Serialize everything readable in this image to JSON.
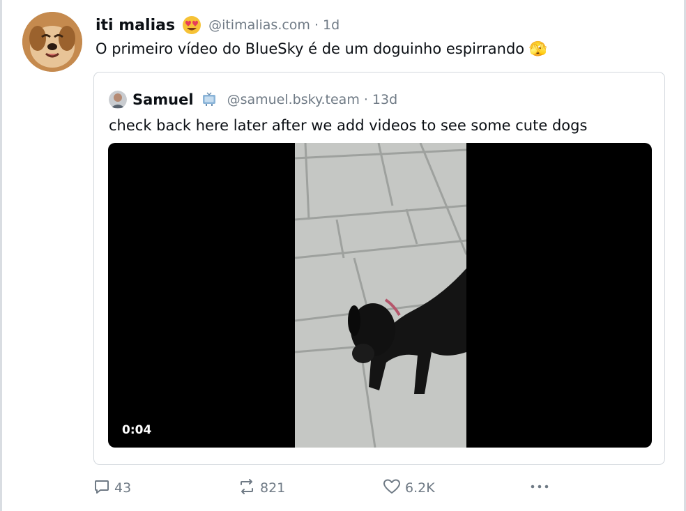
{
  "post": {
    "author": {
      "display_name": "iti malias",
      "emoji": "heart-eyes-emoji",
      "handle": "@itimalias.com",
      "separator": "·",
      "time": "1d"
    },
    "text": "O primeiro vídeo do BlueSky é de um doguinho espirrando 🫣"
  },
  "quote": {
    "author": {
      "display_name": "Samuel",
      "badge": "tv-icon",
      "handle": "@samuel.bsky.team",
      "separator": "·",
      "time": "13d"
    },
    "text": "check back here later after we add videos to see some cute dogs",
    "video": {
      "duration": "0:04"
    }
  },
  "actions": {
    "reply_count": "43",
    "repost_count": "821",
    "like_count": "6.2K"
  },
  "colors": {
    "muted_text": "#6f7a85",
    "border": "#d3d8dd",
    "video_background": "#000000"
  }
}
